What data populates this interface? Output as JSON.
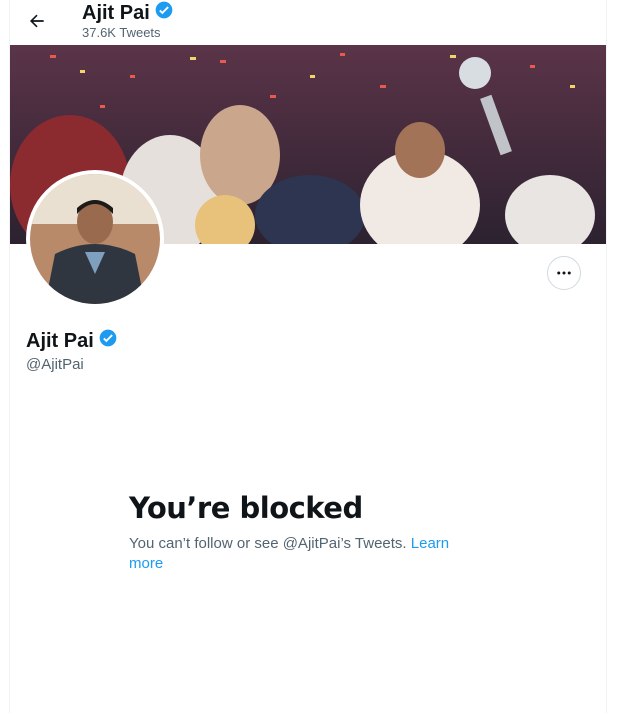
{
  "header": {
    "title": "Ajit Pai",
    "subtitle": "37.6K Tweets",
    "back_icon": "arrow-left-icon"
  },
  "profile": {
    "name": "Ajit Pai",
    "handle": "@AjitPai",
    "verified_icon": "verified-badge-icon",
    "more_icon": "more-horizontal-icon"
  },
  "blocked": {
    "title": "You’re blocked",
    "message": "You can’t follow or see @AjitPai’s Tweets. ",
    "link": "Learn more"
  },
  "colors": {
    "accent": "#1d9bf0",
    "secondary_text": "#536471",
    "primary_text": "#0f1419"
  }
}
